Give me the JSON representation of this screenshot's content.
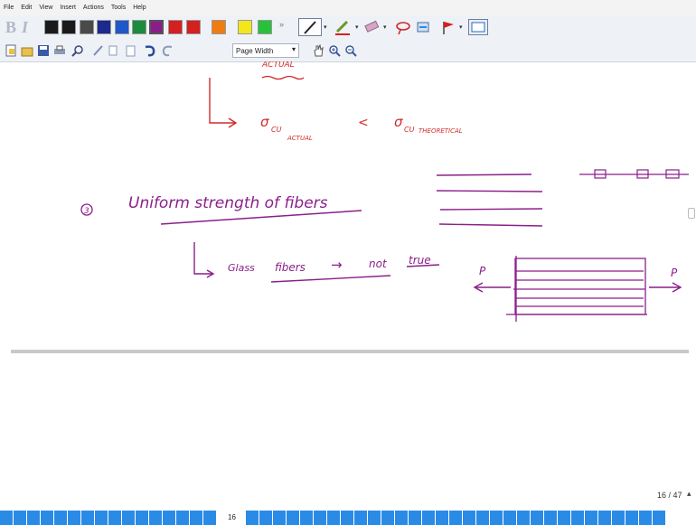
{
  "menu": {
    "items": [
      "File",
      "Edit",
      "View",
      "Insert",
      "Actions",
      "Tools",
      "Help"
    ]
  },
  "toolbar": {
    "format_bold_label": "B",
    "format_italic_label": "I",
    "color_swatches": [
      "#1a1a1a",
      "#1a1a1a",
      "#4a4a4a",
      "#1b2a8c",
      "#1f57c9",
      "#1b8b3e",
      "#8b1d8b",
      "#d42020",
      "#f07c10",
      "#f3e61a",
      "#27c23a"
    ],
    "page_width_label": "Page Width",
    "icons": [
      "new-page-icon",
      "open-icon",
      "save-icon",
      "print-icon",
      "find-icon",
      "pen-icon",
      "copy-icon",
      "paste-icon",
      "undo-icon",
      "redo-icon",
      "hand-icon",
      "zoom-in-icon",
      "zoom-out-icon"
    ]
  },
  "whiteboard": {
    "top_red": {
      "word_fragment": "ACTUAL",
      "sigma_left": "σ",
      "sub_left": "CU",
      "subsub_left": "ACTUAL",
      "less_than": "<",
      "sigma_right": "σ",
      "sub_right": "CU",
      "subsub_right": "THEORETICAL"
    },
    "item3": {
      "number": "3",
      "text": "Uniform strength of fibers"
    },
    "glass": {
      "label": "Glass",
      "word": "fibers",
      "arrow": "→",
      "not": "not",
      "true": "true"
    },
    "load_labels": {
      "left": "P",
      "right": "P"
    }
  },
  "status": {
    "page_indicator": "16 / 47",
    "current_thumb": "16"
  },
  "colors": {
    "ink_red": "#d12a2a",
    "ink_purple": "#8a1f8a",
    "thumb_blue": "#2a8be6"
  }
}
